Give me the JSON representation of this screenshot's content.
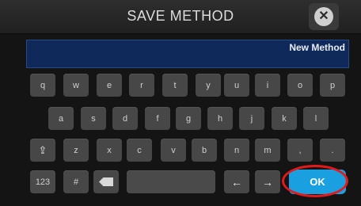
{
  "title": "SAVE METHOD",
  "close_icon": "close-icon",
  "field": {
    "value": "New Method"
  },
  "keyboard": {
    "row1": [
      "q",
      "w",
      "e",
      "r",
      "t",
      "y",
      "u",
      "i",
      "o",
      "p"
    ],
    "row2": [
      "a",
      "s",
      "d",
      "f",
      "g",
      "h",
      "j",
      "k",
      "l"
    ],
    "row3": [
      "z",
      "x",
      "c",
      "v",
      "b",
      "n",
      "m",
      ",",
      "."
    ],
    "numbers_label": "123",
    "hash_label": "#",
    "ok_label": "OK"
  },
  "colors": {
    "ok_button": "#1aa0e0",
    "field_background": "#0f2a5a",
    "highlight_ring": "#e21a1a"
  }
}
